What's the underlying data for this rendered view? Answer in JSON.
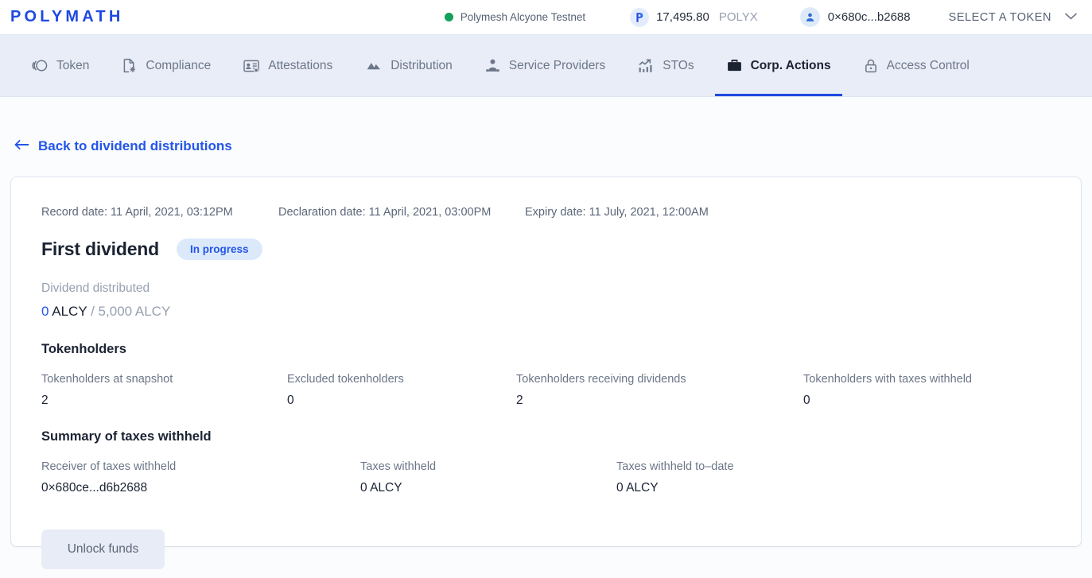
{
  "header": {
    "logo": "POLYMATH",
    "network": {
      "icon": "status-dot-icon",
      "label": "Polymesh Alcyone Testnet",
      "color": "#12a05c"
    },
    "balance": {
      "icon": "polyx-token-icon",
      "amount": "17,495.80",
      "ticker": "POLYX"
    },
    "account": {
      "icon": "user-avatar-icon",
      "address": "0×680c...b2688"
    },
    "token_select": {
      "label": "SELECT A TOKEN",
      "icon": "chevron-down-icon"
    }
  },
  "nav": {
    "items": [
      {
        "label": "Token",
        "icon": "token-icon",
        "active": false
      },
      {
        "label": "Compliance",
        "icon": "document-gear-icon",
        "active": false
      },
      {
        "label": "Attestations",
        "icon": "id-card-gear-icon",
        "active": false
      },
      {
        "label": "Distribution",
        "icon": "mountains-icon",
        "active": false
      },
      {
        "label": "Service Providers",
        "icon": "person-badge-icon",
        "active": false
      },
      {
        "label": "STOs",
        "icon": "bar-chart-arrow-icon",
        "active": false
      },
      {
        "label": "Corp. Actions",
        "icon": "briefcase-icon",
        "active": true
      },
      {
        "label": "Access Control",
        "icon": "lock-icon",
        "active": false
      }
    ],
    "active_accent": "#1f49e0"
  },
  "back_link": {
    "icon": "arrow-left-icon",
    "label": "Back to dividend distributions"
  },
  "card": {
    "dates": {
      "record": "Record date: 11 April, 2021, 03:12PM",
      "declaration": "Declaration date: 11 April, 2021, 03:00PM",
      "expiry": "Expiry date: 11 July, 2021, 12:00AM"
    },
    "title": "First dividend",
    "status": "In progress",
    "distribution": {
      "label": "Dividend distributed",
      "amount": "0",
      "ticker": "ALCY",
      "total": "/ 5,000 ALCY"
    },
    "tokenholders_section": {
      "heading": "Tokenholders",
      "stats": [
        {
          "label": "Tokenholders at snapshot",
          "value": "2"
        },
        {
          "label": "Excluded tokenholders",
          "value": "0"
        },
        {
          "label": "Tokenholders receiving dividends",
          "value": "2"
        },
        {
          "label": "Tokenholders with taxes withheld",
          "value": "0"
        }
      ]
    },
    "taxes_section": {
      "heading": "Summary of taxes withheld",
      "stats": [
        {
          "label": "Receiver of taxes withheld",
          "value": "0×680ce...d6b2688"
        },
        {
          "label": "Taxes withheld",
          "value": "0 ALCY"
        },
        {
          "label": "Taxes withheld to–date",
          "value": "0 ALCY"
        }
      ]
    },
    "unlock_button": "Unlock funds"
  }
}
